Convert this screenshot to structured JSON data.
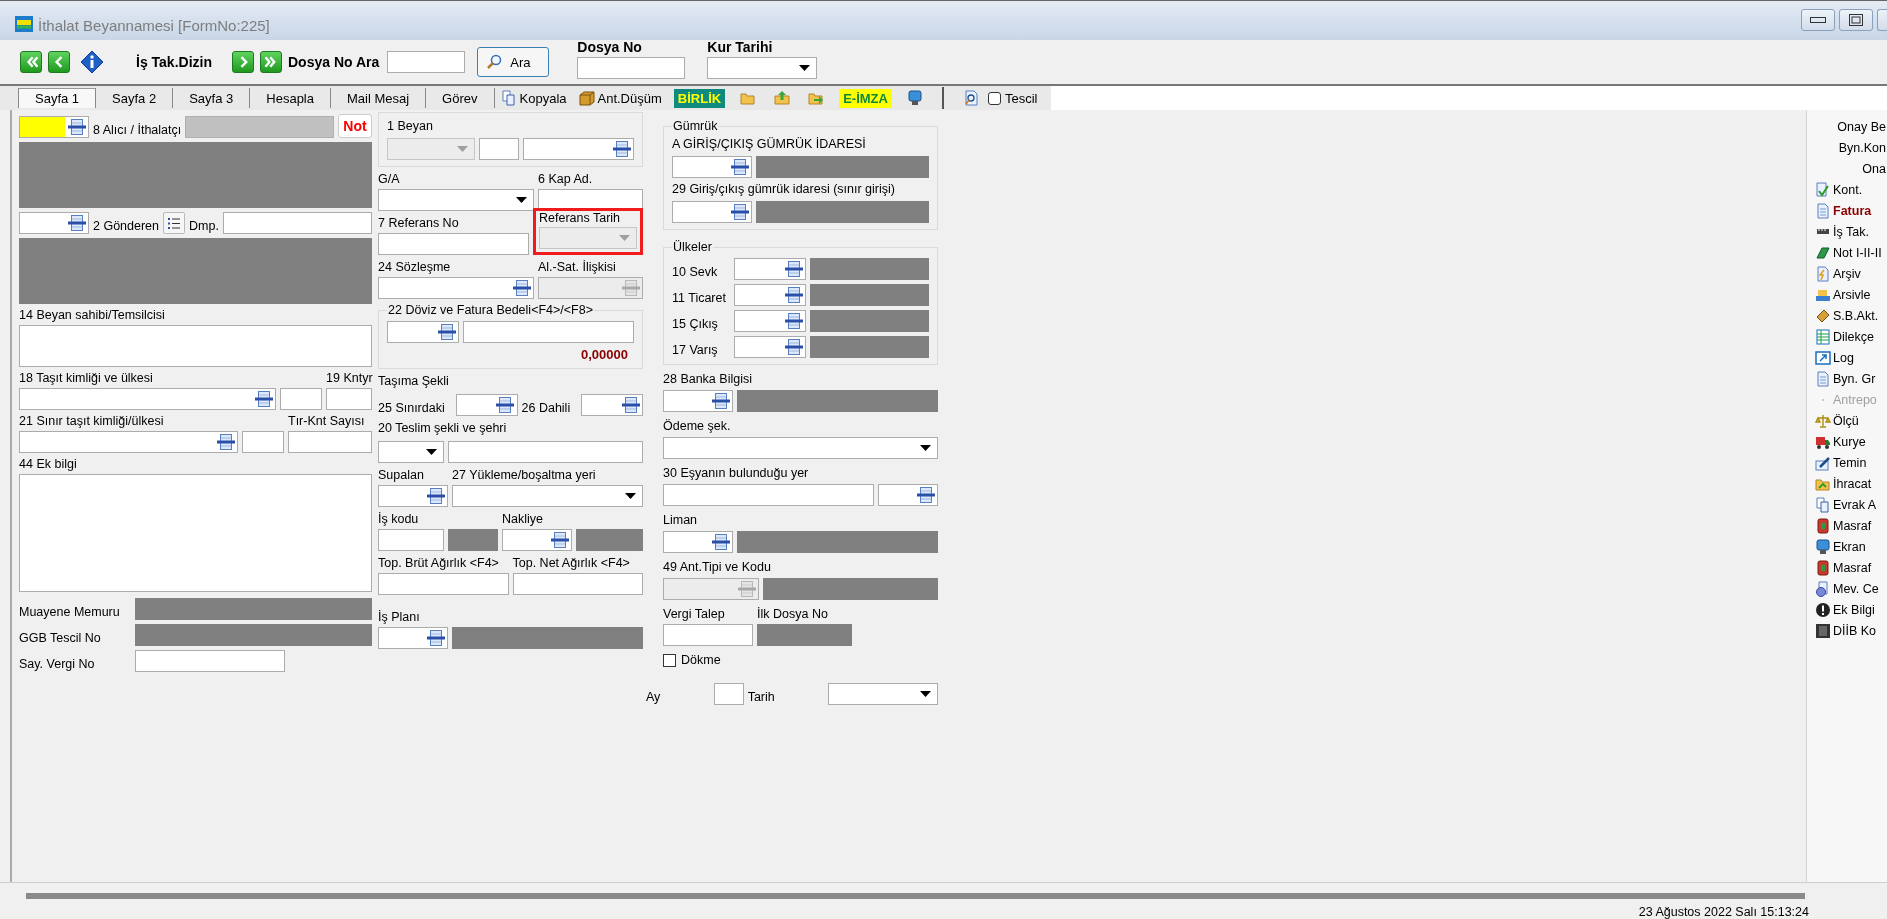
{
  "window": {
    "title": "İthalat Beyannamesi [FormNo:225]"
  },
  "toolbar": {
    "items": [
      {
        "kind": "first_button"
      },
      {
        "kind": "prev_button"
      },
      {
        "kind": "info_button"
      },
      {
        "kind": "label",
        "text": "İş Tak.Dizin"
      },
      {
        "kind": "next_button"
      },
      {
        "kind": "last_button"
      },
      {
        "kind": "label",
        "text": "Dosya No Ara"
      },
      {
        "kind": "input"
      },
      {
        "kind": "search_button",
        "text": "Ara"
      },
      {
        "kind": "field_stack",
        "text": "Dosya No"
      },
      {
        "kind": "dropdown_stack",
        "text": "Kur Tarihi"
      }
    ]
  },
  "tabs": [
    {
      "label": "Sayfa 1",
      "selected": true
    },
    {
      "label": "Sayfa 2",
      "selected": false
    },
    {
      "label": "Sayfa 3",
      "selected": false
    },
    {
      "label": "Hesapla",
      "selected": false
    },
    {
      "label": "Mail Mesaj",
      "selected": false
    },
    {
      "label": "Görev",
      "selected": false
    }
  ],
  "ribbon": [
    {
      "kind": "command",
      "text": "Kopyala"
    },
    {
      "kind": "command",
      "text": "Ant.Düşüm"
    },
    {
      "kind": "badge",
      "text": "BİRLİK",
      "color": "#0e8a7e"
    },
    {
      "kind": "icon_button"
    },
    {
      "kind": "icon_button"
    },
    {
      "kind": "icon_button"
    },
    {
      "kind": "badge",
      "text": "E-İMZA",
      "color": "#ffff00"
    },
    {
      "kind": "icon_button"
    },
    {
      "kind": "separator"
    },
    {
      "kind": "icon_button"
    },
    {
      "kind": "checkbox",
      "text": "Tescil",
      "checked": false
    }
  ],
  "form": {
    "left": {
      "lines": [
        [
          {
            "kind": "lookup",
            "highlighted": true,
            "disabled": false
          },
          {
            "kind": "label",
            "text": "8 Alıcı / İthalatçı"
          },
          {
            "kind": "shaded"
          },
          {
            "kind": "note_button",
            "text": "Not"
          }
        ],
        [
          {
            "kind": "readonly_area"
          }
        ],
        [
          {
            "kind": "lookup",
            "highlighted": false,
            "disabled": false
          },
          {
            "kind": "label",
            "text": "2 Gönderen"
          },
          {
            "kind": "list_button"
          },
          {
            "kind": "label",
            "text": "Dmp."
          },
          {
            "kind": "input"
          }
        ],
        [
          {
            "kind": "readonly_area"
          }
        ],
        [
          {
            "kind": "stack",
            "items": [
              {
                "kind": "label",
                "text": "14 Beyan sahibi/Temsilcisi"
              },
              {
                "kind": "textbox"
              }
            ]
          }
        ],
        [
          {
            "kind": "stack",
            "items": [
              {
                "kind": "label",
                "text": "18 Taşıt kimliği ve ülkesi"
              },
              {
                "kind": "lookup",
                "highlighted": false,
                "disabled": false
              }
            ]
          },
          {
            "kind": "input"
          },
          {
            "kind": "stack",
            "items": [
              {
                "kind": "label",
                "text": "19 Kntyr"
              },
              {
                "kind": "input"
              }
            ]
          }
        ],
        [
          {
            "kind": "stack",
            "items": [
              {
                "kind": "label",
                "text": "21 Sınır taşıt kimliği/ülkesi"
              },
              {
                "kind": "lookup",
                "highlighted": false,
                "disabled": false
              }
            ]
          },
          {
            "kind": "input"
          },
          {
            "kind": "stack",
            "items": [
              {
                "kind": "label",
                "text": "Tır-Knt Sayısı"
              },
              {
                "kind": "input"
              }
            ]
          }
        ],
        [
          {
            "kind": "stack",
            "items": [
              {
                "kind": "label",
                "text": "44 Ek bilgi"
              },
              {
                "kind": "memo"
              }
            ]
          }
        ],
        [
          {
            "kind": "label",
            "text": "Muayene Memuru"
          },
          {
            "kind": "readonly"
          }
        ],
        [
          {
            "kind": "label",
            "text": "GGB Tescil No"
          },
          {
            "kind": "readonly"
          }
        ],
        [
          {
            "kind": "label",
            "text": "Say. Vergi No"
          },
          {
            "kind": "input"
          }
        ]
      ]
    },
    "center": {
      "lines": [
        [
          {
            "kind": "group",
            "flagged": false,
            "lines": [
              [
                {
                  "kind": "label",
                  "text": "1 Beyan"
                }
              ],
              [
                {
                  "kind": "dropdown",
                  "disabled": true
                },
                {
                  "kind": "input"
                },
                {
                  "kind": "lookup",
                  "highlighted": false,
                  "disabled": false
                }
              ]
            ]
          }
        ],
        [
          {
            "kind": "stack",
            "items": [
              {
                "kind": "label",
                "text": "G/A"
              },
              {
                "kind": "dropdown",
                "disabled": false
              }
            ]
          },
          {
            "kind": "stack",
            "items": [
              {
                "kind": "label",
                "text": "6 Kap Ad."
              },
              {
                "kind": "input"
              }
            ]
          }
        ],
        [
          {
            "kind": "stack",
            "items": [
              {
                "kind": "label",
                "text": "7 Referans No"
              },
              {
                "kind": "input"
              }
            ]
          },
          {
            "kind": "group",
            "flagged": true,
            "lines": [
              [
                {
                  "kind": "label",
                  "text": "Referans Tarih"
                }
              ],
              [
                {
                  "kind": "dropdown",
                  "disabled": true
                }
              ]
            ]
          }
        ],
        [
          {
            "kind": "stack",
            "items": [
              {
                "kind": "label",
                "text": "24 Sözleşme"
              },
              {
                "kind": "lookup",
                "highlighted": false,
                "disabled": false
              }
            ]
          },
          {
            "kind": "stack",
            "items": [
              {
                "kind": "label",
                "text": "Al.-Sat. İlişkisi"
              },
              {
                "kind": "lookup",
                "highlighted": false,
                "disabled": true
              }
            ]
          }
        ],
        [
          {
            "kind": "group",
            "legend": "22 Döviz ve Fatura Bedeli<F4>/<F8>",
            "flagged": false,
            "lines": [
              [
                {
                  "kind": "lookup",
                  "highlighted": false,
                  "disabled": false
                },
                {
                  "kind": "input"
                }
              ],
              [
                {
                  "kind": "amount",
                  "text": "0,00000"
                }
              ]
            ]
          }
        ],
        [
          {
            "kind": "label",
            "text": "Taşıma Şekli"
          }
        ],
        [
          {
            "kind": "label",
            "text": "25 Sınırdaki"
          },
          {
            "kind": "lookup",
            "highlighted": false,
            "disabled": false
          },
          {
            "kind": "label",
            "text": "26 Dahili"
          },
          {
            "kind": "lookup",
            "highlighted": false,
            "disabled": false
          }
        ],
        [
          {
            "kind": "label",
            "text": "20 Teslim şekli ve şehri"
          }
        ],
        [
          {
            "kind": "dropdown",
            "disabled": false
          },
          {
            "kind": "input"
          }
        ],
        [
          {
            "kind": "stack",
            "items": [
              {
                "kind": "label",
                "text": "Supalan"
              },
              {
                "kind": "lookup",
                "highlighted": false,
                "disabled": false
              }
            ]
          },
          {
            "kind": "stack",
            "items": [
              {
                "kind": "label",
                "text": "27 Yükleme/boşaltma yeri"
              },
              {
                "kind": "dropdown",
                "disabled": false
              }
            ]
          }
        ],
        [
          {
            "kind": "stack",
            "items": [
              {
                "kind": "label",
                "text": "İş kodu"
              },
              {
                "kind": "input"
              }
            ]
          },
          {
            "kind": "readonly"
          },
          {
            "kind": "stack",
            "items": [
              {
                "kind": "label",
                "text": "Nakliye"
              },
              {
                "kind": "lookup",
                "highlighted": false,
                "disabled": false
              }
            ]
          },
          {
            "kind": "readonly"
          }
        ],
        [
          {
            "kind": "stack",
            "items": [
              {
                "kind": "label",
                "text": "Top. Brüt Ağırlık <F4>"
              },
              {
                "kind": "input"
              }
            ]
          },
          {
            "kind": "stack",
            "items": [
              {
                "kind": "label",
                "text": "Top. Net Ağırlık <F4>"
              },
              {
                "kind": "input"
              }
            ]
          }
        ],
        [
          {
            "kind": "stack",
            "items": [
              {
                "kind": "label",
                "text": "İş Planı"
              },
              {
                "kind": "lookup",
                "highlighted": false,
                "disabled": false
              }
            ]
          },
          {
            "kind": "readonly"
          }
        ]
      ]
    },
    "right": {
      "lines": [
        [
          {
            "kind": "group",
            "legend": "Gümrük",
            "flagged": false,
            "lines": [
              [
                {
                  "kind": "label",
                  "text": "A GİRİŞ/ÇIKIŞ GÜMRÜK İDARESİ"
                }
              ],
              [
                {
                  "kind": "lookup",
                  "highlighted": false,
                  "disabled": false
                },
                {
                  "kind": "readonly"
                }
              ],
              [
                {
                  "kind": "label",
                  "text": "29 Giriş/çıkış gümrük idaresi (sınır girişi)"
                }
              ],
              [
                {
                  "kind": "lookup",
                  "highlighted": false,
                  "disabled": false
                },
                {
                  "kind": "readonly"
                }
              ]
            ]
          }
        ],
        [
          {
            "kind": "group",
            "legend": "Ülkeler",
            "flagged": false,
            "lines": [
              [
                {
                  "kind": "label",
                  "text": "10 Sevk"
                },
                {
                  "kind": "lookup",
                  "highlighted": false,
                  "disabled": false
                },
                {
                  "kind": "readonly"
                }
              ],
              [
                {
                  "kind": "label",
                  "text": "11 Ticaret"
                },
                {
                  "kind": "lookup",
                  "highlighted": false,
                  "disabled": false
                },
                {
                  "kind": "readonly"
                }
              ],
              [
                {
                  "kind": "label",
                  "text": "15 Çıkış"
                },
                {
                  "kind": "lookup",
                  "highlighted": false,
                  "disabled": false
                },
                {
                  "kind": "readonly"
                }
              ],
              [
                {
                  "kind": "label",
                  "text": "17 Varış"
                },
                {
                  "kind": "lookup",
                  "highlighted": false,
                  "disabled": false
                },
                {
                  "kind": "readonly"
                }
              ]
            ]
          }
        ],
        [
          {
            "kind": "label",
            "text": "28 Banka Bilgisi"
          }
        ],
        [
          {
            "kind": "lookup",
            "highlighted": false,
            "disabled": false
          },
          {
            "kind": "readonly"
          }
        ],
        [
          {
            "kind": "label",
            "text": "Ödeme şek."
          }
        ],
        [
          {
            "kind": "dropdown",
            "disabled": false
          }
        ],
        [
          {
            "kind": "label",
            "text": "30 Eşyanın bulunduğu yer"
          }
        ],
        [
          {
            "kind": "input"
          },
          {
            "kind": "lookup",
            "highlighted": false,
            "disabled": false
          }
        ],
        [
          {
            "kind": "label",
            "text": "Liman"
          }
        ],
        [
          {
            "kind": "lookup",
            "highlighted": false,
            "disabled": false
          },
          {
            "kind": "readonly"
          }
        ],
        [
          {
            "kind": "label",
            "text": "49 Ant.Tipi ve Kodu"
          }
        ],
        [
          {
            "kind": "lookup",
            "highlighted": false,
            "disabled": true
          },
          {
            "kind": "readonly"
          }
        ],
        [
          {
            "kind": "stack",
            "items": [
              {
                "kind": "label",
                "text": "Vergi Talep"
              },
              {
                "kind": "input"
              }
            ]
          },
          {
            "kind": "stack",
            "items": [
              {
                "kind": "label",
                "text": "İlk Dosya No"
              },
              {
                "kind": "readonly"
              }
            ]
          }
        ],
        [
          {
            "kind": "checkbox",
            "text": "Dökme",
            "checked": false
          }
        ],
        [
          {
            "kind": "label",
            "text": "Ay"
          },
          {
            "kind": "input"
          },
          {
            "kind": "label",
            "text": "Tarih"
          },
          {
            "kind": "dropdown",
            "disabled": false
          }
        ]
      ]
    }
  },
  "sidebar": {
    "items": [
      {
        "kind": "text",
        "label": "Onay Be",
        "highlighted": false,
        "disabled": false
      },
      {
        "kind": "text",
        "label": "Byn.Kon",
        "highlighted": false,
        "disabled": false
      },
      {
        "kind": "text",
        "label": "Ona",
        "highlighted": false,
        "disabled": false
      },
      {
        "kind": "command",
        "label": "Kont.",
        "highlighted": false,
        "disabled": false
      },
      {
        "kind": "command",
        "label": "Fatura",
        "highlighted": true,
        "disabled": false
      },
      {
        "kind": "command",
        "label": "İş Tak.",
        "highlighted": false,
        "disabled": false
      },
      {
        "kind": "command",
        "label": "Not I-II-II",
        "highlighted": false,
        "disabled": false
      },
      {
        "kind": "command",
        "label": "Arşiv",
        "highlighted": false,
        "disabled": false
      },
      {
        "kind": "command",
        "label": "Arsivle",
        "highlighted": false,
        "disabled": false
      },
      {
        "kind": "command",
        "label": "S.B.Akt.",
        "highlighted": false,
        "disabled": false
      },
      {
        "kind": "command",
        "label": "Dilekçe",
        "highlighted": false,
        "disabled": false
      },
      {
        "kind": "command",
        "label": "Log",
        "highlighted": false,
        "disabled": false
      },
      {
        "kind": "command",
        "label": "Byn. Gr",
        "highlighted": false,
        "disabled": false
      },
      {
        "kind": "command",
        "label": "Antrepo",
        "highlighted": false,
        "disabled": true
      },
      {
        "kind": "command",
        "label": "Ölçü",
        "highlighted": false,
        "disabled": false
      },
      {
        "kind": "command",
        "label": "Kurye",
        "highlighted": false,
        "disabled": false
      },
      {
        "kind": "command",
        "label": "Temin",
        "highlighted": false,
        "disabled": false
      },
      {
        "kind": "command",
        "label": "İhracat",
        "highlighted": false,
        "disabled": false
      },
      {
        "kind": "command",
        "label": "Evrak A",
        "highlighted": false,
        "disabled": false
      },
      {
        "kind": "command",
        "label": "Masraf",
        "highlighted": false,
        "disabled": false
      },
      {
        "kind": "command",
        "label": "Ekran",
        "highlighted": false,
        "disabled": false
      },
      {
        "kind": "command",
        "label": "Masraf",
        "highlighted": false,
        "disabled": false
      },
      {
        "kind": "command",
        "label": "Mev. Ce",
        "highlighted": false,
        "disabled": false
      },
      {
        "kind": "command",
        "label": "Ek Bilgi",
        "highlighted": false,
        "disabled": false
      },
      {
        "kind": "command",
        "label": "DİİB Ko",
        "highlighted": false,
        "disabled": false
      }
    ]
  },
  "status_bar": {
    "text": "23 Ağustos 2022 Salı 15:13:24"
  }
}
